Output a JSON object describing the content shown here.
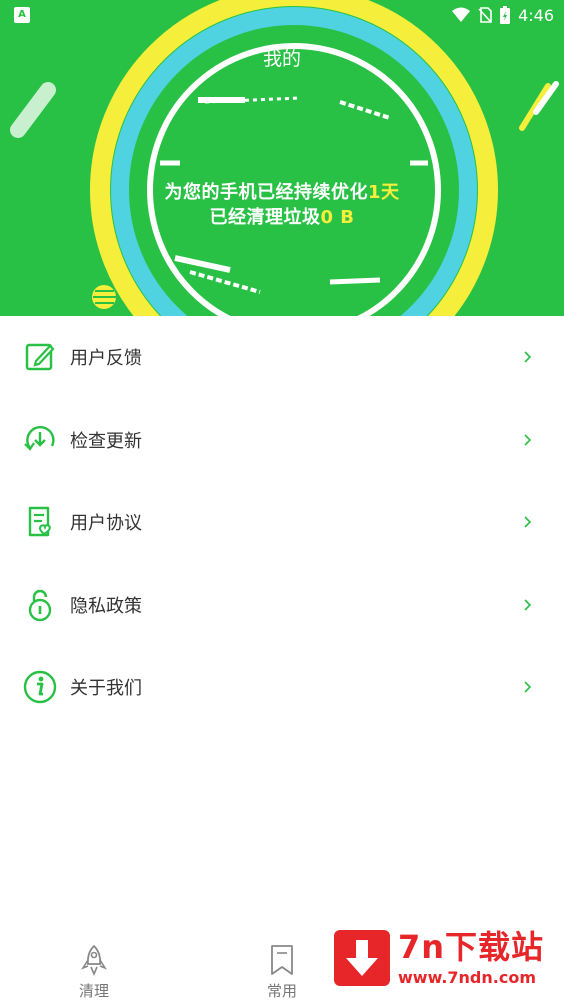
{
  "status_bar": {
    "time": "4:46"
  },
  "header": {
    "title": "我的",
    "line1_text": "为您的手机已经持续优化",
    "line1_value": "1天",
    "line2_text": "已经清理垃圾",
    "line2_value": "0 B"
  },
  "colors": {
    "brand_green": "#29c145",
    "accent_yellow": "#f5ee3b",
    "accent_cyan": "#4fd3e0",
    "watermark_red": "#e7262a"
  },
  "menu": {
    "items": [
      {
        "label": "用户反馈",
        "icon": "edit-icon"
      },
      {
        "label": "检查更新",
        "icon": "download-update-icon"
      },
      {
        "label": "用户协议",
        "icon": "agreement-icon"
      },
      {
        "label": "隐私政策",
        "icon": "lock-icon"
      },
      {
        "label": "关于我们",
        "icon": "info-icon"
      }
    ]
  },
  "tabbar": {
    "tabs": [
      {
        "label": "清理",
        "icon": "rocket-icon"
      },
      {
        "label": "常用",
        "icon": "bookmark-icon"
      }
    ]
  },
  "watermark": {
    "title": "7n下载站",
    "url": "www.7ndn.com"
  }
}
